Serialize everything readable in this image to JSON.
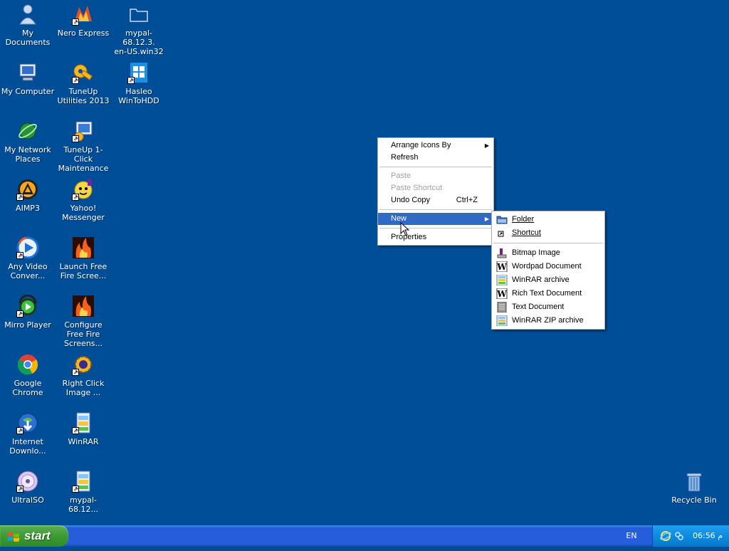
{
  "desktop": {
    "icons": [
      {
        "label": "My Documents",
        "icon": "my-documents-icon"
      },
      {
        "label": "Nero Express",
        "icon": "nero-express-icon"
      },
      {
        "label": "mypal-68.12.3.\nen-US.win32",
        "icon": "folder-icon"
      },
      {
        "label": "My Computer",
        "icon": "my-computer-icon"
      },
      {
        "label": "TuneUp Utilities 2013",
        "icon": "tuneup-utilities-icon"
      },
      {
        "label": "Hasleo WinToHDD",
        "icon": "hasleo-wintohdd-icon"
      },
      {
        "label": "My Network Places",
        "icon": "network-places-icon"
      },
      {
        "label": "TuneUp 1-Click Maintenance",
        "icon": "tuneup-maintenance-icon"
      },
      {
        "label": "AIMP3",
        "icon": "aimp3-icon"
      },
      {
        "label": "Yahoo! Messenger",
        "icon": "yahoo-messenger-icon"
      },
      {
        "label": "Any Video Conver...",
        "icon": "any-video-converter-icon"
      },
      {
        "label": "Launch Free Fire Scree...",
        "icon": "fire-screensaver-icon"
      },
      {
        "label": "Mirro Player",
        "icon": "mirro-player-icon"
      },
      {
        "label": "Configure Free Fire Screens...",
        "icon": "fire-screensaver-icon"
      },
      {
        "label": "Google Chrome",
        "icon": "google-chrome-icon"
      },
      {
        "label": "Right Click Image ...",
        "icon": "right-click-image-icon"
      },
      {
        "label": "Internet Downlo...",
        "icon": "internet-download-icon"
      },
      {
        "label": "WinRAR",
        "icon": "winrar-icon"
      },
      {
        "label": "UltraISO",
        "icon": "ultraiso-icon"
      },
      {
        "label": "mypal-68.12...",
        "icon": "winrar-archive-icon"
      },
      {
        "label": "Recycle Bin",
        "icon": "recycle-bin-icon"
      }
    ]
  },
  "context_menu": {
    "items": [
      {
        "label": "Arrange Icons By",
        "submenu": true
      },
      {
        "label": "Refresh"
      },
      {
        "label": "Paste",
        "disabled": true
      },
      {
        "label": "Paste Shortcut",
        "disabled": true
      },
      {
        "label": "Undo Copy",
        "accel": "Ctrl+Z"
      },
      {
        "label": "New",
        "submenu": true,
        "selected": true
      },
      {
        "label": "Properties"
      }
    ],
    "arrow_glyph": "▶"
  },
  "new_submenu": {
    "items": [
      {
        "label": "Folder",
        "icon": "folder-icon"
      },
      {
        "label": "Shortcut",
        "icon": "shortcut-icon"
      },
      {
        "label": "Bitmap Image",
        "icon": "bitmap-icon"
      },
      {
        "label": "Wordpad Document",
        "icon": "wordpad-icon"
      },
      {
        "label": "WinRAR archive",
        "icon": "winrar-archive-icon"
      },
      {
        "label": "Rich Text Document",
        "icon": "rich-text-icon"
      },
      {
        "label": "Text Document",
        "icon": "text-document-icon"
      },
      {
        "label": "WinRAR ZIP archive",
        "icon": "winrar-zip-icon"
      }
    ]
  },
  "taskbar": {
    "start_label": "start",
    "language": "EN",
    "clock": "06:56 م"
  },
  "colors": {
    "desktop": "#004e98",
    "selection": "#316ac5"
  }
}
